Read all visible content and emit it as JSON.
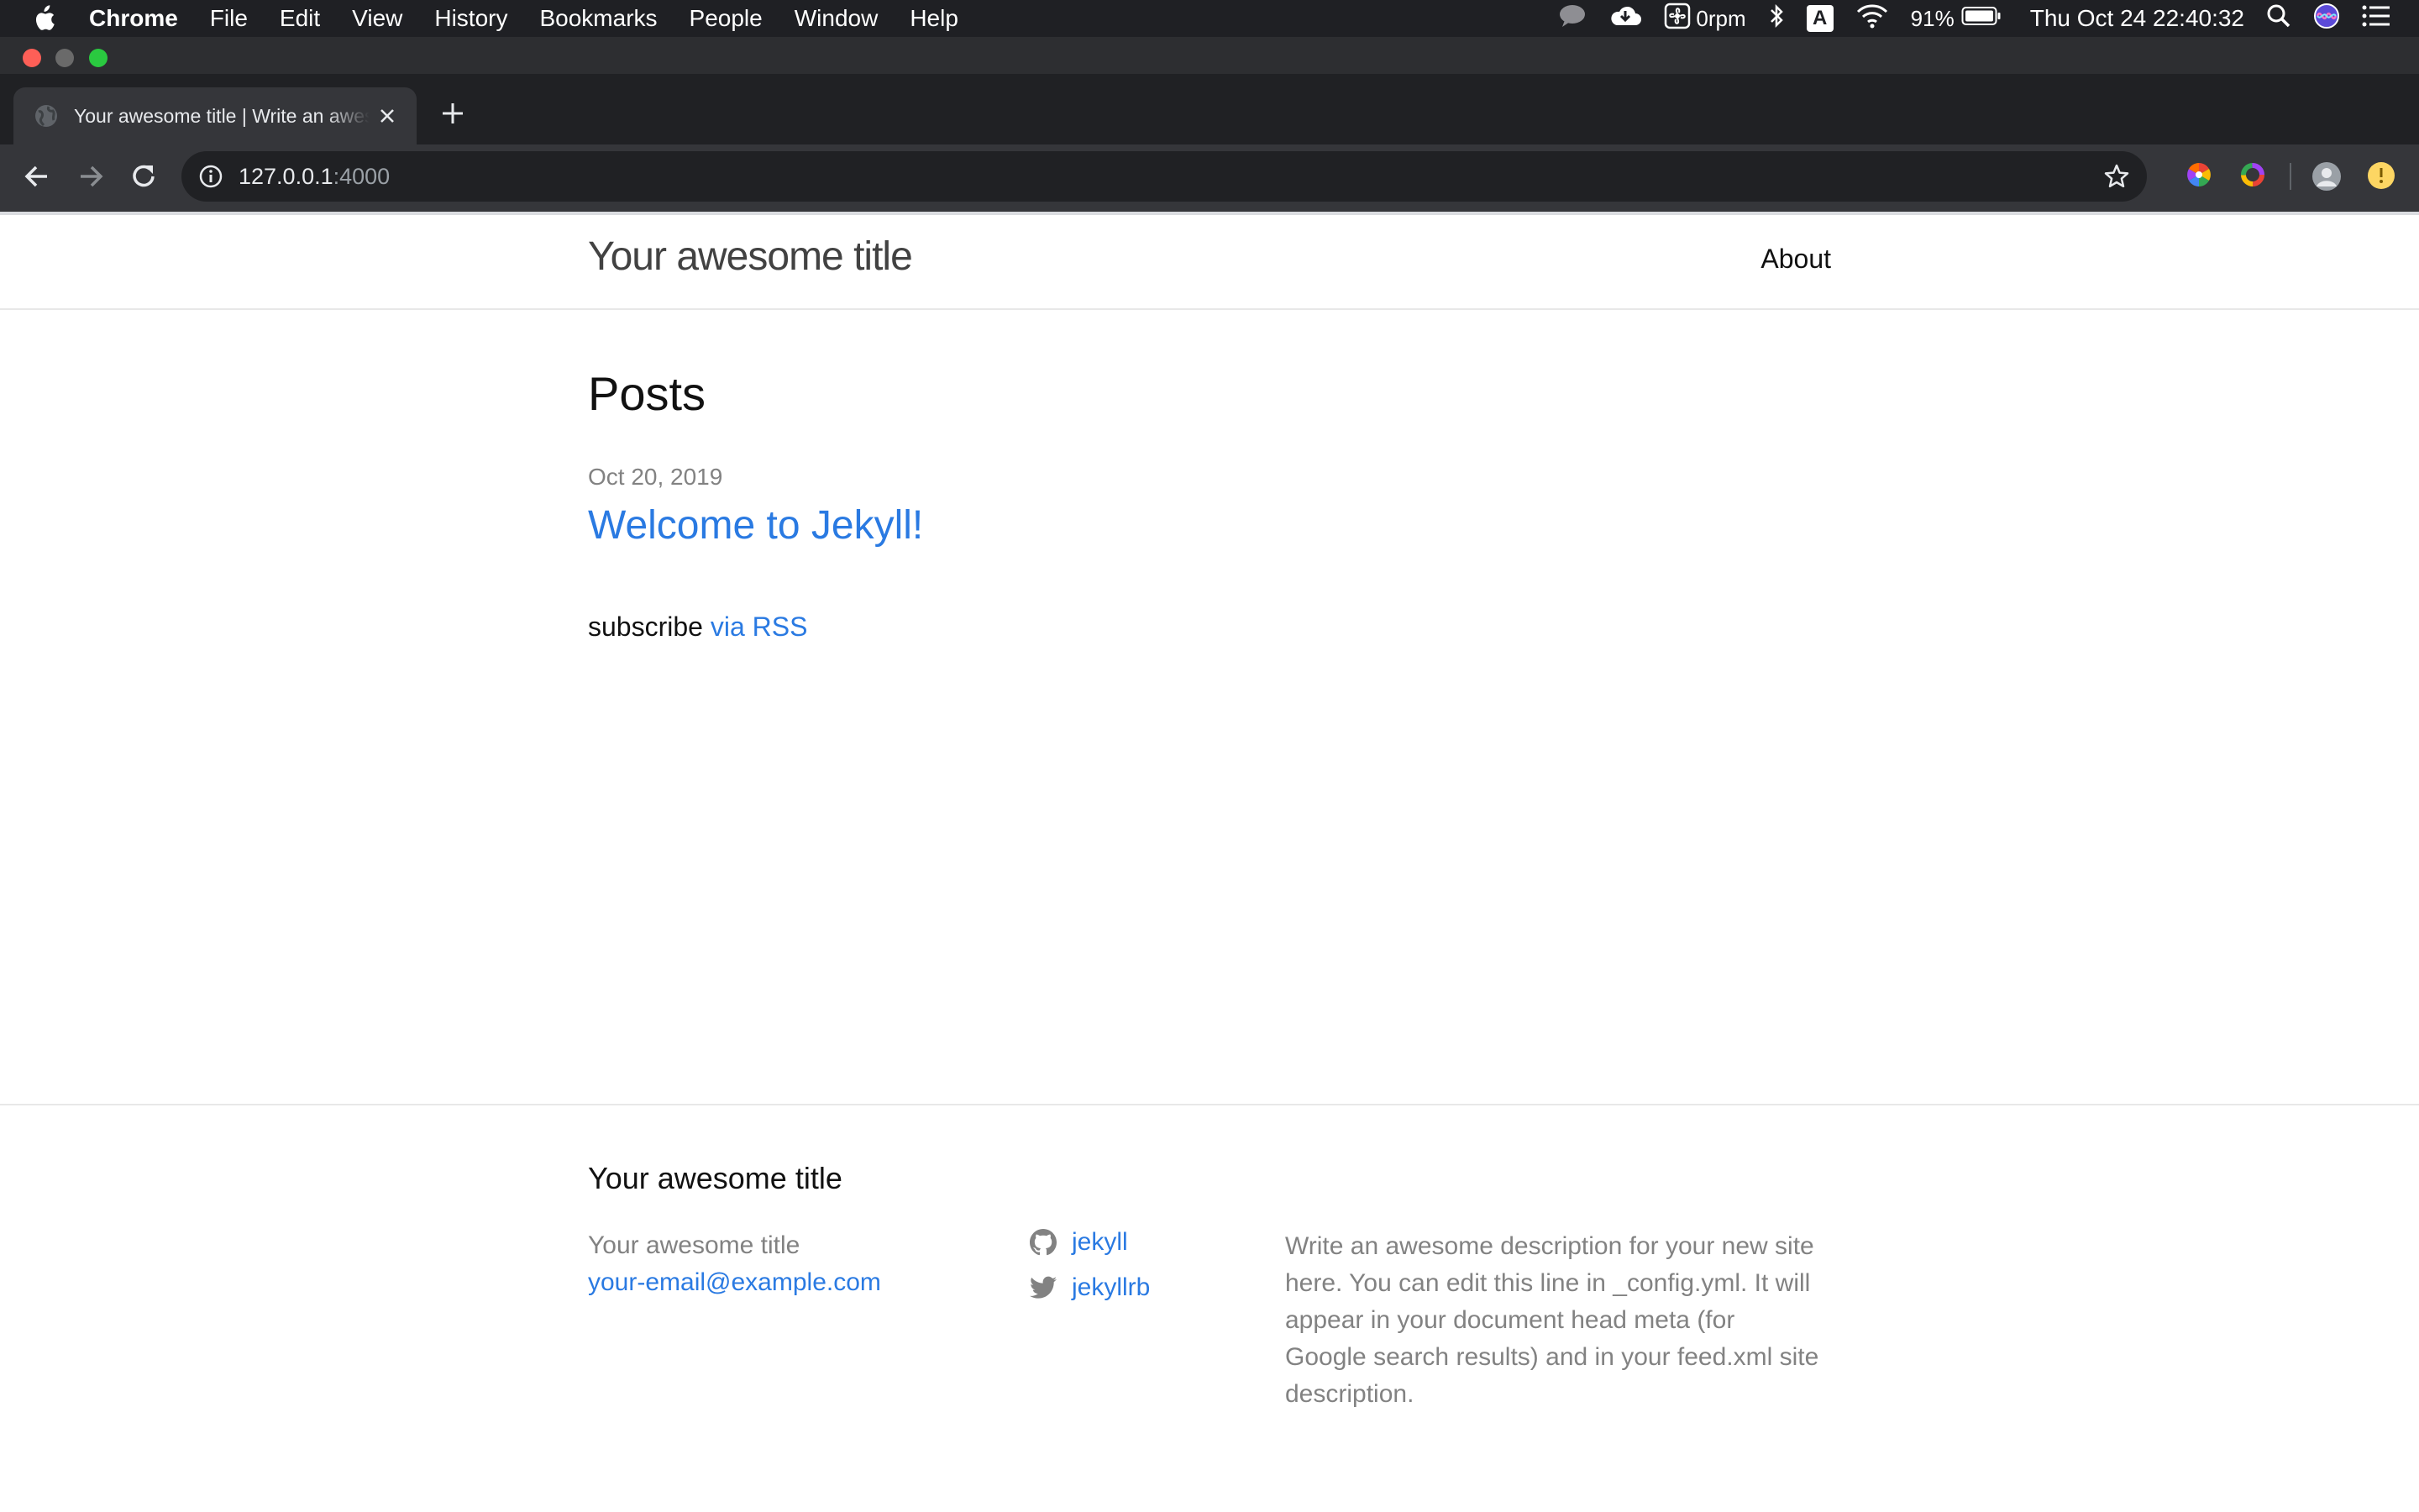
{
  "os_menubar": {
    "app_name": "Chrome",
    "menus": [
      "File",
      "Edit",
      "View",
      "History",
      "Bookmarks",
      "People",
      "Window",
      "Help"
    ],
    "fan_text": "0rpm",
    "input_source": "A",
    "battery_percent": "91%",
    "clock": "Thu Oct 24  22:40:32"
  },
  "browser": {
    "tab_title": "Your awesome title | Write an awesome description for your new site",
    "url_host": "127.0.0.1",
    "url_port": ":4000"
  },
  "page": {
    "site_title": "Your awesome title",
    "nav": {
      "about": "About"
    },
    "posts_heading": "Posts",
    "posts": [
      {
        "date": "Oct 20, 2019",
        "title": "Welcome to Jekyll!"
      }
    ],
    "subscribe_text": "subscribe",
    "subscribe_link": "via RSS"
  },
  "footer": {
    "heading": "Your awesome title",
    "name": "Your awesome title",
    "email": "your-email@example.com",
    "github_user": "jekyll",
    "twitter_user": "jekyllrb",
    "description": "Write an awesome description for your new site here. You can edit this line in _config.yml. It will appear in your document head meta (for Google search results) and in your feed.xml site description."
  },
  "colors": {
    "link": "#2a7ae2",
    "muted_text": "#828282",
    "body_text": "#111111",
    "menubar_bg": "#1f2024",
    "toolbar_bg": "#35363a"
  },
  "icons": {
    "menubar": [
      "apple-logo-icon",
      "messages-icon",
      "cloud-sync-icon",
      "fan-icon",
      "bluetooth-icon",
      "input-source-icon",
      "wifi-icon",
      "battery-icon",
      "spotlight-search-icon",
      "siri-icon",
      "notification-center-icon"
    ],
    "browser": [
      "favicon-globe-icon",
      "tab-close-icon",
      "new-tab-plus-icon",
      "back-arrow-icon",
      "forward-arrow-icon",
      "reload-icon",
      "site-info-icon",
      "bookmark-star-icon",
      "color-extension-icon",
      "ring-extension-icon",
      "profile-avatar-icon",
      "update-indicator-icon"
    ],
    "footer": [
      "github-icon",
      "twitter-icon"
    ]
  }
}
